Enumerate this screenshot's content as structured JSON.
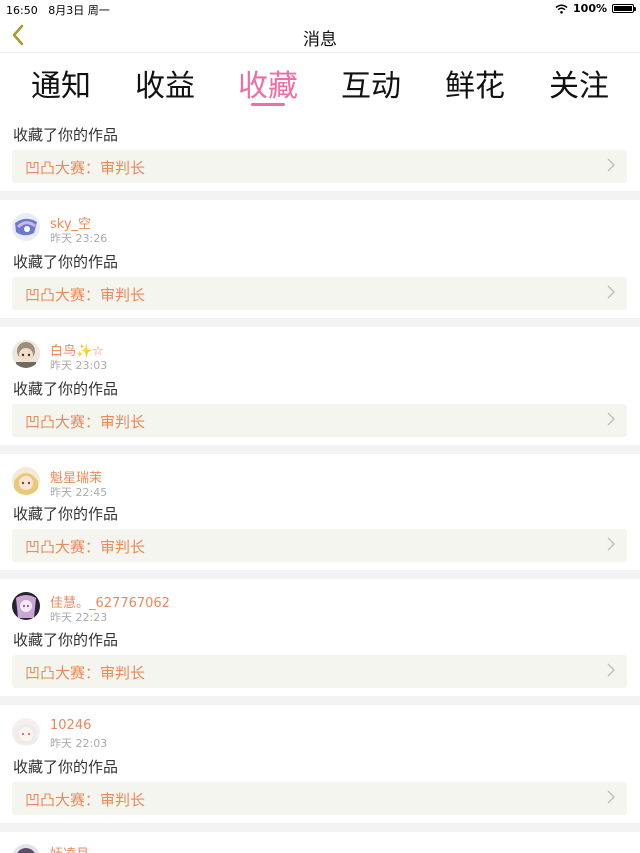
{
  "status_bar": {
    "time": "16:50",
    "date": "8月3日 周一",
    "battery": "100%"
  },
  "header": {
    "title": "消息"
  },
  "tabs": [
    {
      "label": "通知"
    },
    {
      "label": "收益"
    },
    {
      "label": "收藏",
      "active": true
    },
    {
      "label": "互动"
    },
    {
      "label": "鲜花"
    },
    {
      "label": "关注"
    }
  ],
  "colors": {
    "accent": "#ee6fa6",
    "link": "#e98a5a",
    "box_bg": "#f5f5ef"
  },
  "icons": {
    "back": "chevron-left-icon",
    "more": "chevron-right-icon"
  },
  "items": [
    {
      "user": "",
      "time": "",
      "action": "收藏了你的作品",
      "work": "凹凸大赛：审判长"
    },
    {
      "user": "sky_空",
      "time": "昨天 23:26",
      "action": "收藏了你的作品",
      "work": "凹凸大赛：审判长"
    },
    {
      "user": "白鸟✨☆",
      "time": "昨天 23:03",
      "action": "收藏了你的作品",
      "work": "凹凸大赛：审判长"
    },
    {
      "user": "魁星瑞茉",
      "time": "昨天 22:45",
      "action": "收藏了你的作品",
      "work": "凹凸大赛：审判长"
    },
    {
      "user": "佳慧。_627767062",
      "time": "昨天 22:23",
      "action": "收藏了你的作品",
      "work": "凹凸大赛：审判长"
    },
    {
      "user": "10246",
      "time": "昨天 22:03",
      "action": "收藏了你的作品",
      "work": "凹凸大赛：审判长"
    },
    {
      "user": "妩凌月",
      "time": "",
      "action": "",
      "work": ""
    }
  ]
}
